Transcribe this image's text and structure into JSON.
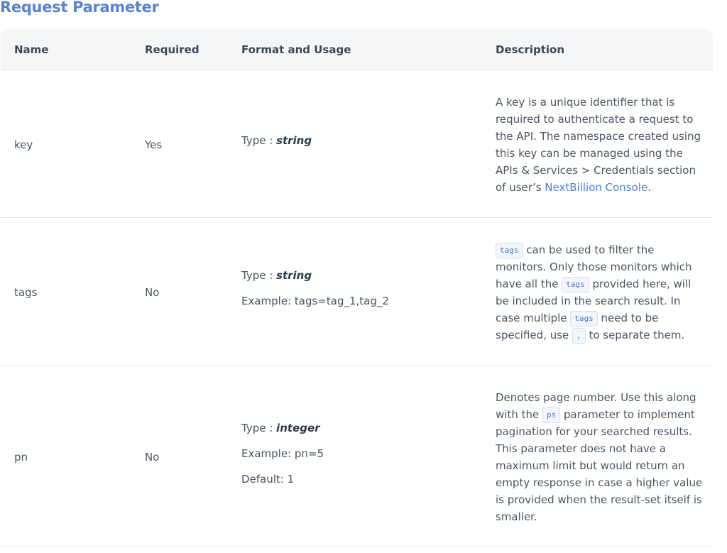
{
  "title": "Request Parameter",
  "headers": {
    "name": "Name",
    "required": "Required",
    "format": "Format and Usage",
    "description": "Description"
  },
  "rows": [
    {
      "name": "key",
      "required": "Yes",
      "type_label": "Type : ",
      "type_value": "string",
      "desc_text": "A key is a unique identifier that is required to authenticate a request to the API. The namespace created using this key can be managed using the APIs & Services > Credentials section of user’s ",
      "desc_link": "NextBillion Console",
      "desc_end": "."
    },
    {
      "name": "tags",
      "required": "No",
      "type_label": "Type : ",
      "type_value": "string",
      "example": "Example: tags=tag_1,tag_2",
      "desc": {
        "code_tags": "tags",
        "code_comma": ",",
        "t1": " can be used to filter the monitors. Only those monitors which have all the ",
        "t2": " provided here, will be included in the search result. In case multiple ",
        "t3": " need to be specified, use ",
        "t4": " to separate them."
      }
    },
    {
      "name": "pn",
      "required": "No",
      "type_label": "Type : ",
      "type_value": "integer",
      "example": "Example: pn=5",
      "default": "Default: 1",
      "desc": {
        "t1": "Denotes page number. Use this along with the ",
        "code_ps": "ps",
        "t2": " parameter to implement pagination for your searched results. This parameter does not have a maximum limit but would return an empty response in case a higher value is provided when the result-set itself is smaller."
      }
    }
  ]
}
